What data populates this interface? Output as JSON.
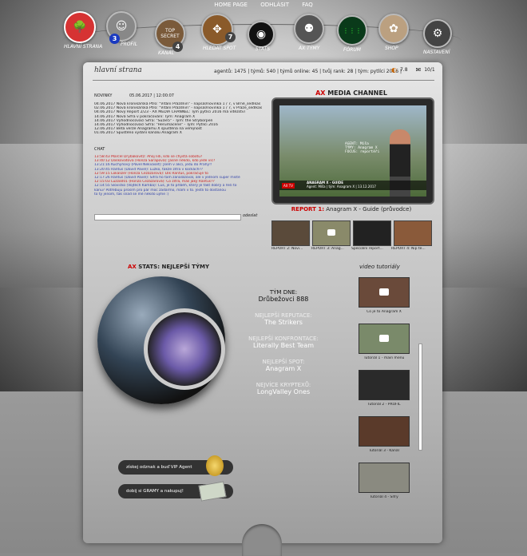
{
  "topbar": {
    "home": "HOME PAGE",
    "logout": "ODHLÁSIT",
    "faq": "FAQ"
  },
  "nav": [
    {
      "label": "HLAVNÍ STRANA",
      "color": "#d63333",
      "icon": "tree-icon"
    },
    {
      "label": "PROFIL",
      "color": "#777777",
      "icon": "profile-icon",
      "badge": "3"
    },
    {
      "label": "KANÁL",
      "color": "#7a5a3a",
      "icon": "topsecret-icon",
      "badge": "4"
    },
    {
      "label": "HLEDAT SPOT",
      "color": "#8a5a2a",
      "icon": "compass-icon",
      "badge": "7"
    },
    {
      "label": "STATS",
      "color": "#111111",
      "icon": "orb-icon"
    },
    {
      "label": "AX TÝMY",
      "color": "#555555",
      "icon": "team-icon"
    },
    {
      "label": "FÓRUM",
      "color": "#0a3a1a",
      "icon": "matrix-icon"
    },
    {
      "label": "SHOP",
      "color": "#bba080",
      "icon": "shop-icon"
    },
    {
      "label": "NASTAVENÍ",
      "color": "#444444",
      "icon": "gear-icon"
    }
  ],
  "header": {
    "title": "hlavní strana",
    "stats": "agentů: 1475 | týmů: 540 | týmů online: 45 | tvůj rank: 28 | tým: pytlíci 2016 |",
    "rating": "7.8",
    "messages": "10/1"
  },
  "news": {
    "heading": "NOVINKY",
    "date": "05.06.2017 | 12:00:07",
    "items": [
      "04.06.2017 Nová kronikářská Ptro: \"Vítání Prázdnin\" - napsal/novinka 1 / 7, v Brně_sedlkas",
      "02.06.2017 Nová kronikářská Ptro: \"Vítání Prázdnin\" - napsal/novinka 1 / 7, v Praze_sedlkas",
      "04.06.2017 Nový Report 2/23 - AX MEDIA CHANNEL: Tým pytlíci 2016 má vítězství",
      "14.06.2017 Nová Šifra v pokračování: Tým: Anagram X",
      "14.06.2017 Vyhodnocovací Šifra: \"Suzie5\" - Tým: the Stryborpen",
      "14.06.2017 Vyhodnocovací Šifra: \"Herumacene\" - Tým: Pytlíci 2016",
      "12.06.2017 Beta verze Anagramu X spuštěna na veřejnost",
      "01.06.2017 Spuštěno vydání kanálu Anagram X"
    ]
  },
  "chat": {
    "heading": "CHAT",
    "items": [
      {
        "text": "13:58:43 Marcel Drybakovitz: Ahoj lidi, kdo se chystá sobotu?",
        "color": "#cc2222"
      },
      {
        "text": "13:40:12 Doskovatova (Honza Šarapová): Jasně někdo, kdo jede víc?",
        "color": "#cc2222"
      },
      {
        "text": "13:21:16 Kuchyňový (Pavel Nekvaset): Jsem v akci, jedu do Prahy!!",
        "color": "#3344aa"
      },
      {
        "text": "13:20:45 Rantus (David Pavel): Luzko, takže zítra v kočkách??",
        "color": "#3344aa"
      },
      {
        "text": "12:59:15 Lokalizér (Honza Cezázarová): Dík Rantus, pokračuje to",
        "color": "#cc2222"
      },
      {
        "text": "12:17:26 Rantus (David Pavel): Šifra ho tam zanalázoval, ale v jednom super místě",
        "color": "#3344aa"
      },
      {
        "text": "12:15:03 Luzzo001 (Honza Cezázarová): Co zítra, máš jaký Rantus??",
        "color": "#cc2222"
      },
      {
        "text": "12:14:55 Slovičko (Vojtěch Kamba): Čus, je to příběh, který je fakt dobrý a řeší to",
        "color": "#3344aa"
      },
      {
        "text": "kanu? Potřebuju prosím pro pár moc zadarmo, mám v to. Jestli to dostanou",
        "color": "#3344aa"
      },
      {
        "text": "to ty jenom, tak snad se mě někdo ujme :)",
        "color": "#3344aa"
      }
    ],
    "send_label": "odeslat"
  },
  "media": {
    "title_prefix": "AX",
    "title_rest": " MEDIA CHANNEL",
    "caption": "AGENT: Míša\nTÝMY: Anagram X\nFOCUS: reportéři",
    "bar_title": "ANAGRAM X - GUIDE",
    "bar_sub": "Agent: Míša | tým: Anagram X | 13.12.2017",
    "logo": "AX TV",
    "report_prefix": "REPORT 1:",
    "report_rest": " Anagram X - Guide (průvodce)",
    "thumbs": [
      {
        "caption": "REPORT 2: Novi...",
        "color": "#5a4a3a"
      },
      {
        "caption": "REPORT 3: Anag...",
        "color": "#8a8a6a"
      },
      {
        "caption": "Speciální report...",
        "color": "#222222"
      },
      {
        "caption": "REPORT 4: Nip te...",
        "color": "#8a5a3a"
      }
    ]
  },
  "stats_section": {
    "title_prefix": "AX",
    "title_rest": " STATS: NEJLEPŠÍ TÝMY",
    "teams": [
      {
        "label": "TÝM DNE:",
        "value": "Drůbežovci 888"
      },
      {
        "label": "NEJLEPŠÍ REPUTACE:",
        "value": "The Strikers"
      },
      {
        "label": "NEJLEPŠÍ KONFRONTACE:",
        "value": "Literally Best Team"
      },
      {
        "label": "NEJLEPŠÍ SPOT:",
        "value": "Anagram X"
      },
      {
        "label": "NEJVÍCE KRYPTEXŮ:",
        "value": "LongValley Ones"
      }
    ]
  },
  "video_tutorials": {
    "heading": "video tutoriály",
    "items": [
      {
        "caption": "Co je to Anagram X",
        "color": "#6a4a3a"
      },
      {
        "caption": "Tutoriál 1 - main menu",
        "color": "#7a8a6a"
      },
      {
        "caption": "Tutoriál 2 - PROFIL",
        "color": "#2a2a2a"
      },
      {
        "caption": "Tutoriál 3 - Kanál",
        "color": "#5a3a2a"
      },
      {
        "caption": "Tutoriál 4 - Šifry",
        "color": "#8a8a80"
      }
    ]
  },
  "buttons": {
    "vip": "získej odznak a buď VIP Agent",
    "grams": "dobij si GRAMY a nakupuj!"
  }
}
